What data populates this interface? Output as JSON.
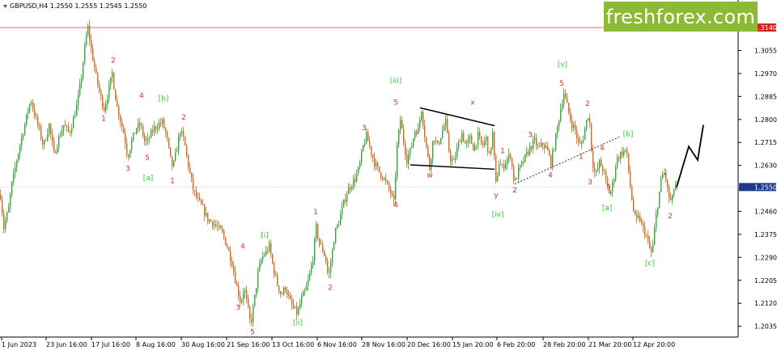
{
  "header": {
    "symbol_text": "GBPUSD,H4  1.2550 1.2555 1.2545 1.2550"
  },
  "logo": {
    "text": "freshforex.com"
  },
  "colors": {
    "bull": "#3aa43a",
    "bear": "#d2691e",
    "wave_red": "#e0312b",
    "wave_green": "#2bcf2b",
    "level_line": "#e56b6b",
    "current_price_box": "#1e3a8a",
    "resistance_box": "#d21f1f",
    "logo_bg": "#8dba36"
  },
  "chart_data": {
    "type": "candlestick",
    "title": "",
    "xlabel": "",
    "ylabel": "",
    "ylim": [
      1.1995,
      1.32
    ],
    "y_ticks": [
      "1.3140",
      "1.3055",
      "1.2970",
      "1.2885",
      "1.2800",
      "1.2715",
      "1.2630",
      "1.2550",
      "1.2460",
      "1.2375",
      "1.2290",
      "1.2205",
      "1.2120",
      "1.2035"
    ],
    "x_ticks": [
      "1 Jun 2023",
      "23 Jun 16:00",
      "17 Jul 16:00",
      "8 Aug 16:00",
      "30 Aug 16:00",
      "21 Sep 16:00",
      "13 Oct 16:00",
      "6 Nov 16:00",
      "28 Nov 16:00",
      "20 Dec 16:00",
      "15 Jan 20:00",
      "6 Feb 20:00",
      "28 Feb 20:00",
      "21 Mar 20:00",
      "12 Apr 20:00"
    ],
    "resistance_level": 1.314,
    "current_price": 1.255,
    "price_path": [
      [
        0,
        1.252
      ],
      [
        4,
        1.24
      ],
      [
        10,
        1.247
      ],
      [
        14,
        1.256
      ],
      [
        20,
        1.265
      ],
      [
        25,
        1.272
      ],
      [
        30,
        1.278
      ],
      [
        35,
        1.285
      ],
      [
        38,
        1.287
      ],
      [
        42,
        1.282
      ],
      [
        48,
        1.276
      ],
      [
        53,
        1.27
      ],
      [
        60,
        1.278
      ],
      [
        66,
        1.267
      ],
      [
        72,
        1.273
      ],
      [
        78,
        1.278
      ],
      [
        85,
        1.275
      ],
      [
        90,
        1.28
      ],
      [
        95,
        1.286
      ],
      [
        100,
        1.296
      ],
      [
        105,
        1.309
      ],
      [
        108,
        1.314
      ],
      [
        112,
        1.306
      ],
      [
        118,
        1.296
      ],
      [
        124,
        1.288
      ],
      [
        128,
        1.284
      ],
      [
        133,
        1.29
      ],
      [
        138,
        1.297
      ],
      [
        143,
        1.286
      ],
      [
        148,
        1.28
      ],
      [
        153,
        1.274
      ],
      [
        157,
        1.266
      ],
      [
        162,
        1.272
      ],
      [
        168,
        1.277
      ],
      [
        173,
        1.278
      ],
      [
        178,
        1.272
      ],
      [
        182,
        1.272
      ],
      [
        188,
        1.276
      ],
      [
        194,
        1.278
      ],
      [
        200,
        1.279
      ],
      [
        205,
        1.274
      ],
      [
        210,
        1.265
      ],
      [
        213,
        1.262
      ],
      [
        217,
        1.268
      ],
      [
        222,
        1.276
      ],
      [
        227,
        1.272
      ],
      [
        232,
        1.263
      ],
      [
        238,
        1.254
      ],
      [
        244,
        1.25
      ],
      [
        250,
        1.247
      ],
      [
        256,
        1.243
      ],
      [
        262,
        1.242
      ],
      [
        268,
        1.24
      ],
      [
        274,
        1.238
      ],
      [
        280,
        1.233
      ],
      [
        286,
        1.227
      ],
      [
        292,
        1.218
      ],
      [
        297,
        1.212
      ],
      [
        301,
        1.218
      ],
      [
        305,
        1.211
      ],
      [
        309,
        1.204
      ],
      [
        313,
        1.212
      ],
      [
        318,
        1.223
      ],
      [
        323,
        1.229
      ],
      [
        328,
        1.231
      ],
      [
        332,
        1.233
      ],
      [
        337,
        1.225
      ],
      [
        342,
        1.219
      ],
      [
        347,
        1.215
      ],
      [
        352,
        1.218
      ],
      [
        357,
        1.213
      ],
      [
        362,
        1.21
      ],
      [
        367,
        1.208
      ],
      [
        371,
        1.213
      ],
      [
        376,
        1.216
      ],
      [
        381,
        1.221
      ],
      [
        386,
        1.229
      ],
      [
        390,
        1.24
      ],
      [
        394,
        1.234
      ],
      [
        398,
        1.232
      ],
      [
        402,
        1.228
      ],
      [
        405,
        1.221
      ],
      [
        409,
        1.229
      ],
      [
        413,
        1.238
      ],
      [
        418,
        1.242
      ],
      [
        423,
        1.248
      ],
      [
        428,
        1.253
      ],
      [
        433,
        1.256
      ],
      [
        438,
        1.258
      ],
      [
        443,
        1.262
      ],
      [
        448,
        1.27
      ],
      [
        452,
        1.274
      ],
      [
        457,
        1.269
      ],
      [
        462,
        1.264
      ],
      [
        467,
        1.261
      ],
      [
        472,
        1.259
      ],
      [
        477,
        1.256
      ],
      [
        482,
        1.253
      ],
      [
        486,
        1.249
      ],
      [
        490,
        1.27
      ],
      [
        494,
        1.28
      ],
      [
        498,
        1.272
      ],
      [
        502,
        1.265
      ],
      [
        507,
        1.269
      ],
      [
        512,
        1.276
      ],
      [
        516,
        1.276
      ],
      [
        520,
        1.284
      ],
      [
        525,
        1.272
      ],
      [
        530,
        1.262
      ],
      [
        535,
        1.274
      ],
      [
        540,
        1.27
      ],
      [
        545,
        1.275
      ],
      [
        550,
        1.279
      ],
      [
        555,
        1.266
      ],
      [
        560,
        1.264
      ],
      [
        565,
        1.27
      ],
      [
        570,
        1.275
      ],
      [
        575,
        1.27
      ],
      [
        580,
        1.273
      ],
      [
        585,
        1.269
      ],
      [
        590,
        1.274
      ],
      [
        595,
        1.27
      ],
      [
        600,
        1.273
      ],
      [
        604,
        1.266
      ],
      [
        608,
        1.275
      ],
      [
        612,
        1.256
      ],
      [
        616,
        1.264
      ],
      [
        620,
        1.262
      ],
      [
        625,
        1.265
      ],
      [
        630,
        1.267
      ],
      [
        635,
        1.256
      ],
      [
        640,
        1.261
      ],
      [
        645,
        1.264
      ],
      [
        650,
        1.267
      ],
      [
        655,
        1.27
      ],
      [
        660,
        1.272
      ],
      [
        665,
        1.269
      ],
      [
        670,
        1.271
      ],
      [
        675,
        1.269
      ],
      [
        680,
        1.264
      ],
      [
        684,
        1.27
      ],
      [
        688,
        1.277
      ],
      [
        692,
        1.284
      ],
      [
        696,
        1.29
      ],
      [
        700,
        1.285
      ],
      [
        705,
        1.279
      ],
      [
        710,
        1.276
      ],
      [
        715,
        1.27
      ],
      [
        719,
        1.272
      ],
      [
        723,
        1.278
      ],
      [
        727,
        1.283
      ],
      [
        731,
        1.265
      ],
      [
        735,
        1.259
      ],
      [
        740,
        1.264
      ],
      [
        745,
        1.261
      ],
      [
        749,
        1.256
      ],
      [
        753,
        1.252
      ],
      [
        757,
        1.257
      ],
      [
        761,
        1.265
      ],
      [
        765,
        1.267
      ],
      [
        769,
        1.268
      ],
      [
        773,
        1.269
      ],
      [
        777,
        1.258
      ],
      [
        781,
        1.248
      ],
      [
        785,
        1.242
      ],
      [
        789,
        1.244
      ],
      [
        793,
        1.24
      ],
      [
        797,
        1.238
      ],
      [
        801,
        1.233
      ],
      [
        805,
        1.23
      ],
      [
        809,
        1.242
      ],
      [
        813,
        1.251
      ],
      [
        817,
        1.259
      ],
      [
        821,
        1.26
      ],
      [
        825,
        1.252
      ],
      [
        829,
        1.249
      ],
      [
        833,
        1.256
      ],
      [
        836,
        1.255
      ]
    ],
    "forecast": [
      [
        836,
        1.255
      ],
      [
        851,
        1.27
      ],
      [
        862,
        1.265
      ],
      [
        869,
        1.278
      ]
    ],
    "trendlines": [
      {
        "style": "solid",
        "points": [
          [
            519,
            1.2843
          ],
          [
            611,
            1.2777
          ]
        ]
      },
      {
        "style": "solid",
        "points": [
          [
            507,
            1.2632
          ],
          [
            611,
            1.2616
          ]
        ]
      },
      {
        "style": "dashed",
        "points": [
          [
            636,
            1.2561
          ],
          [
            767,
            1.2738
          ]
        ]
      }
    ],
    "annotations": [
      {
        "text": "1",
        "x": 128,
        "y": 1.2795,
        "color": "red"
      },
      {
        "text": "2",
        "x": 140,
        "y": 1.301,
        "color": "red"
      },
      {
        "text": "3",
        "x": 158,
        "y": 1.261,
        "color": "red"
      },
      {
        "text": "4",
        "x": 175,
        "y": 1.288,
        "color": "red"
      },
      {
        "text": "5",
        "x": 182,
        "y": 1.265,
        "color": "red"
      },
      {
        "text": "[a]",
        "x": 183,
        "y": 1.2575,
        "color": "green"
      },
      {
        "text": "[b]",
        "x": 202,
        "y": 1.287,
        "color": "green"
      },
      {
        "text": "1",
        "x": 213,
        "y": 1.2565,
        "color": "red"
      },
      {
        "text": "2",
        "x": 227,
        "y": 1.28,
        "color": "red"
      },
      {
        "text": "4",
        "x": 300,
        "y": 1.2322,
        "color": "red"
      },
      {
        "text": "3",
        "x": 294,
        "y": 1.2095,
        "color": "red"
      },
      {
        "text": "5",
        "x": 312,
        "y": 1.2005,
        "color": "red"
      },
      {
        "text": "[i]",
        "x": 327,
        "y": 1.2363,
        "color": "green"
      },
      {
        "text": "[ii]",
        "x": 368,
        "y": 1.204,
        "color": "green"
      },
      {
        "text": "1",
        "x": 390,
        "y": 1.245,
        "color": "red"
      },
      {
        "text": "2",
        "x": 408,
        "y": 1.217,
        "color": "red"
      },
      {
        "text": "3",
        "x": 450,
        "y": 1.276,
        "color": "red"
      },
      {
        "text": "4",
        "x": 489,
        "y": 1.2475,
        "color": "red"
      },
      {
        "text": "5",
        "x": 489,
        "y": 1.2855,
        "color": "red"
      },
      {
        "text": "[iii]",
        "x": 489,
        "y": 1.2935,
        "color": "green"
      },
      {
        "text": "w",
        "x": 531,
        "y": 1.2585,
        "color": "red"
      },
      {
        "text": "x",
        "x": 584,
        "y": 1.2855,
        "color": "red"
      },
      {
        "text": "y",
        "x": 613,
        "y": 1.2513,
        "color": "red"
      },
      {
        "text": "[iv]",
        "x": 615,
        "y": 1.244,
        "color": "green"
      },
      {
        "text": "1",
        "x": 621,
        "y": 1.2675,
        "color": "red"
      },
      {
        "text": "2",
        "x": 636,
        "y": 1.253,
        "color": "red"
      },
      {
        "text": "3",
        "x": 655,
        "y": 1.2735,
        "color": "red"
      },
      {
        "text": "4",
        "x": 680,
        "y": 1.2585,
        "color": "red"
      },
      {
        "text": "5",
        "x": 694,
        "y": 1.2925,
        "color": "red"
      },
      {
        "text": "[v]",
        "x": 695,
        "y": 1.2995,
        "color": "green"
      },
      {
        "text": "2",
        "x": 726,
        "y": 1.285,
        "color": "red"
      },
      {
        "text": "1",
        "x": 718,
        "y": 1.2655,
        "color": "red"
      },
      {
        "text": "4",
        "x": 744,
        "y": 1.2685,
        "color": "red"
      },
      {
        "text": "3",
        "x": 729,
        "y": 1.256,
        "color": "red"
      },
      {
        "text": "5",
        "x": 752,
        "y": 1.254,
        "color": "red"
      },
      {
        "text": "[a]",
        "x": 750,
        "y": 1.2465,
        "color": "green"
      },
      {
        "text": "[b]",
        "x": 776,
        "y": 1.2738,
        "color": "green"
      },
      {
        "text": "[c]",
        "x": 803,
        "y": 1.226,
        "color": "green"
      },
      {
        "text": "1",
        "x": 822,
        "y": 1.2597,
        "color": "red"
      },
      {
        "text": "2",
        "x": 828,
        "y": 1.2435,
        "color": "red"
      }
    ]
  }
}
